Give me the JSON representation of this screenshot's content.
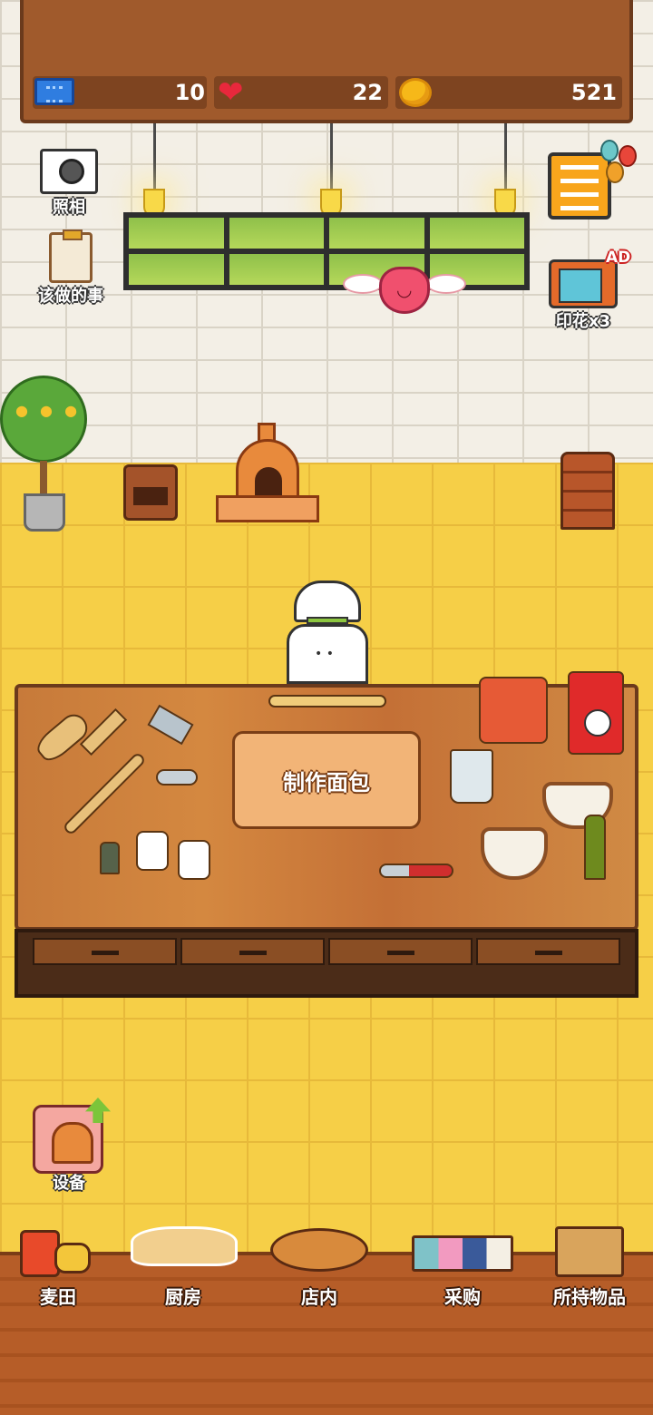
{
  "hud": {
    "tickets": "10",
    "hearts": "22",
    "coins": "521",
    "icons": [
      "ticket-icon",
      "heart-icon",
      "coin-icon"
    ]
  },
  "side_buttons": {
    "camera_label": "照相",
    "todo_label": "该做的事",
    "stamp_label": "印花x3",
    "ad_badge": "AD"
  },
  "workbench": {
    "make_bread_label": "制作面包"
  },
  "equipment": {
    "label": "设备"
  },
  "bottom_nav": {
    "items": [
      {
        "label": "麦田",
        "icon": "wheat-field-icon"
      },
      {
        "label": "厨房",
        "icon": "kitchen-icon"
      },
      {
        "label": "店内",
        "icon": "shop-bread-icon"
      },
      {
        "label": "采购",
        "icon": "purchase-icon"
      },
      {
        "label": "所持物品",
        "icon": "inventory-box-icon"
      }
    ]
  },
  "colors": {
    "heart": "#e8283c",
    "coin": "#f6b819",
    "ticket": "#2f7de0",
    "floor": "#f6cf47",
    "wood": "#a05a2c"
  }
}
